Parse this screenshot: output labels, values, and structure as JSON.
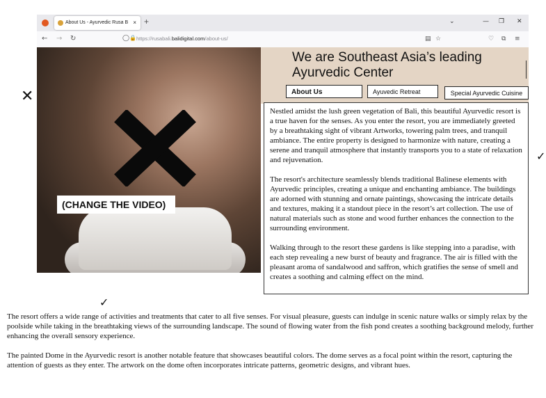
{
  "browser": {
    "tab_title": "About Us - Ayurvedic Rusa Bali",
    "tab_close": "×",
    "new_tab": "+",
    "url_prefix": "https://rusabali.",
    "url_domain": "balidigital.com",
    "url_path": "/about-us/",
    "icons": [
      "back-icon",
      "forward-icon",
      "reload-icon",
      "shield-icon",
      "lock-icon",
      "reader-icon",
      "star-icon",
      "pocket-icon",
      "extensions-icon",
      "menu-icon",
      "chevron-down-icon",
      "minimize-icon",
      "restore-icon",
      "close-icon"
    ]
  },
  "hero": {
    "overlay_label": "(CHANGE THE VIDEO)"
  },
  "page": {
    "heading": "We are Southeast Asia’s leading Ayurvedic Center",
    "buttons": [
      "About Us",
      "Ayuvedic Retreat",
      "Special Ayurvedic Cuisine"
    ],
    "paragraphs": [
      "Nestled amidst the lush green vegetation of Bali, this beautiful Ayurvedic resort is a true haven for the senses. As you enter the resort, you are immediately greeted by a breathtaking sight of vibrant Artworks, towering palm trees, and tranquil ambiance. The entire property is designed to harmonize with nature, creating a serene and tranquil atmosphere that instantly transports you to a state of relaxation and rejuvenation.",
      "The resort's architecture seamlessly blends traditional Balinese elements with Ayurvedic principles, creating a unique and enchanting ambiance. The buildings are adorned with stunning and ornate paintings, showcasing the intricate details and textures, making it a standout piece in the resort’s art collection. The use of natural materials such as stone and wood further enhances the connection to the surrounding environment.",
      "Walking through to the resort these gardens is like stepping into a paradise, with each step revealing a new burst of beauty and fragrance. The air is filled with the pleasant aroma of sandalwood and saffron, which gratifies the sense of smell and creates a soothing and calming effect on the mind."
    ],
    "bottom_paragraphs": [
      "The resort offers a wide range of activities and treatments that cater to all five senses. For visual pleasure, guests can indulge in scenic nature walks or simply relax by the poolside while taking in the breathtaking views of the surrounding landscape. The sound of flowing water from the fish pond creates a soothing background melody, further enhancing the overall sensory experience.",
      "The painted Dome in the Ayurvedic resort is another notable feature that showcases beautiful colors. The dome serves as a focal point within the resort, capturing the attention of guests as they enter. The artwork on the dome often incorporates intricate patterns, geometric designs, and vibrant hues."
    ]
  },
  "marks": {
    "cross": "✕",
    "check": "✓"
  }
}
